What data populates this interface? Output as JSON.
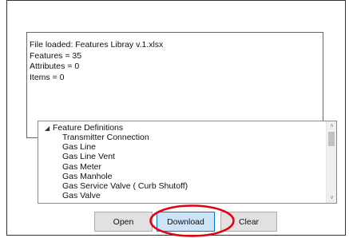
{
  "log": {
    "lines": [
      "File loaded: Features Libray v.1.xlsx",
      "Features = 35",
      "Attributes = 0",
      "Items = 0"
    ]
  },
  "tree": {
    "root_label": "Feature Definitions",
    "expand_glyph": "◢",
    "children": [
      "Transmitter Connection",
      "Gas Line",
      "Gas Line Vent",
      "Gas Meter",
      "Gas Manhole",
      "Gas Service Valve ( Curb Shutoff)",
      "Gas Valve"
    ],
    "scroll_up_glyph": "∧",
    "scroll_down_glyph": "∨"
  },
  "buttons": {
    "open": "Open",
    "download": "Download",
    "clear": "Clear"
  },
  "colors": {
    "highlight_ring": "#e3000f",
    "download_focus_bg": "#cce4f7",
    "download_focus_border": "#0078d7"
  }
}
